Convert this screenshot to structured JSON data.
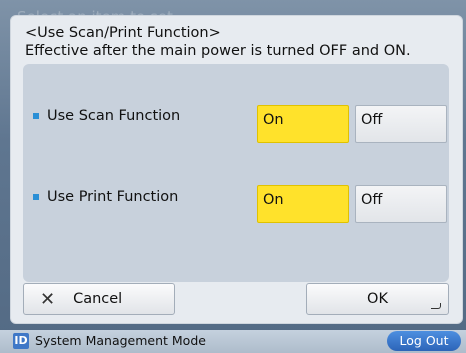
{
  "background_title": "Select an item to set",
  "dialog": {
    "header_line1": "<Use Scan/Print Function>",
    "header_line2": "Effective after the main power is turned OFF and ON."
  },
  "settings": [
    {
      "label": "Use Scan Function",
      "on_label": "On",
      "off_label": "Off",
      "selected": "On"
    },
    {
      "label": "Use Print Function",
      "on_label": "On",
      "off_label": "Off",
      "selected": "On"
    }
  ],
  "buttons": {
    "cancel_label": "Cancel",
    "ok_label": "OK"
  },
  "footer": {
    "id_badge": "ID",
    "mode": "System Management Mode",
    "logout_label": "Log Out"
  },
  "colors": {
    "selected": "#ffe22b",
    "bullet": "#2a8fd6",
    "logout": "#3a78cf"
  }
}
